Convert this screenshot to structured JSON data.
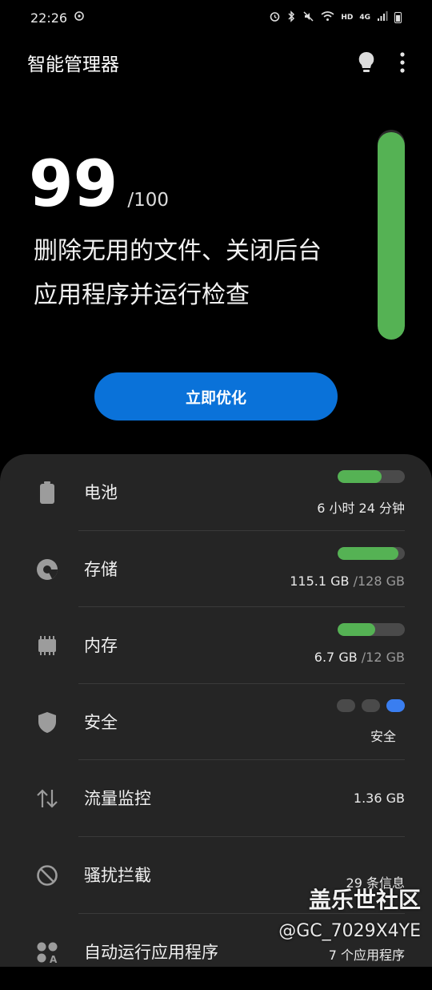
{
  "status_bar": {
    "time": "22:26",
    "icons": [
      "sync-icon",
      "alarm-icon",
      "bluetooth-icon",
      "mute-icon",
      "wifi-icon",
      "signal-icon",
      "battery-icon"
    ],
    "hd": "HD",
    "network": "4G"
  },
  "header": {
    "title": "智能管理器",
    "tips_icon": "lightbulb-icon",
    "menu_icon": "more-vertical-icon"
  },
  "score": {
    "value": "99",
    "max": "/100",
    "description": "删除无用的文件、关闭后台应用程序并运行检查",
    "meter_fraction": 0.99,
    "meter_color": "#55b254"
  },
  "optimize_button": "立即优化",
  "items": [
    {
      "icon": "battery-icon",
      "label": "电池",
      "value": "6 小时 24 分钟",
      "bar_fraction": 0.65
    },
    {
      "icon": "storage-icon",
      "label": "存储",
      "value_main": "115.1 GB",
      "value_total": "/128 GB",
      "bar_fraction": 0.9
    },
    {
      "icon": "memory-icon",
      "label": "内存",
      "value_main": "6.7 GB",
      "value_total": "/12 GB",
      "bar_fraction": 0.56
    },
    {
      "icon": "shield-icon",
      "label": "安全",
      "value": "安全",
      "level": 3
    },
    {
      "icon": "data-transfer-icon",
      "label": "流量监控",
      "value": "1.36 GB"
    },
    {
      "icon": "block-icon",
      "label": "骚扰拦截",
      "value": "29 条信息"
    },
    {
      "icon": "auto-run-icon",
      "label": "自动运行应用程序",
      "value": "7 个应用程序"
    }
  ],
  "watermark": {
    "brand": "盖乐世社区",
    "user": "@GC_7029X4YE"
  },
  "colors": {
    "accent_green": "#55b254",
    "button_blue": "#0a72d9",
    "security_blue": "#3a7ef0"
  }
}
